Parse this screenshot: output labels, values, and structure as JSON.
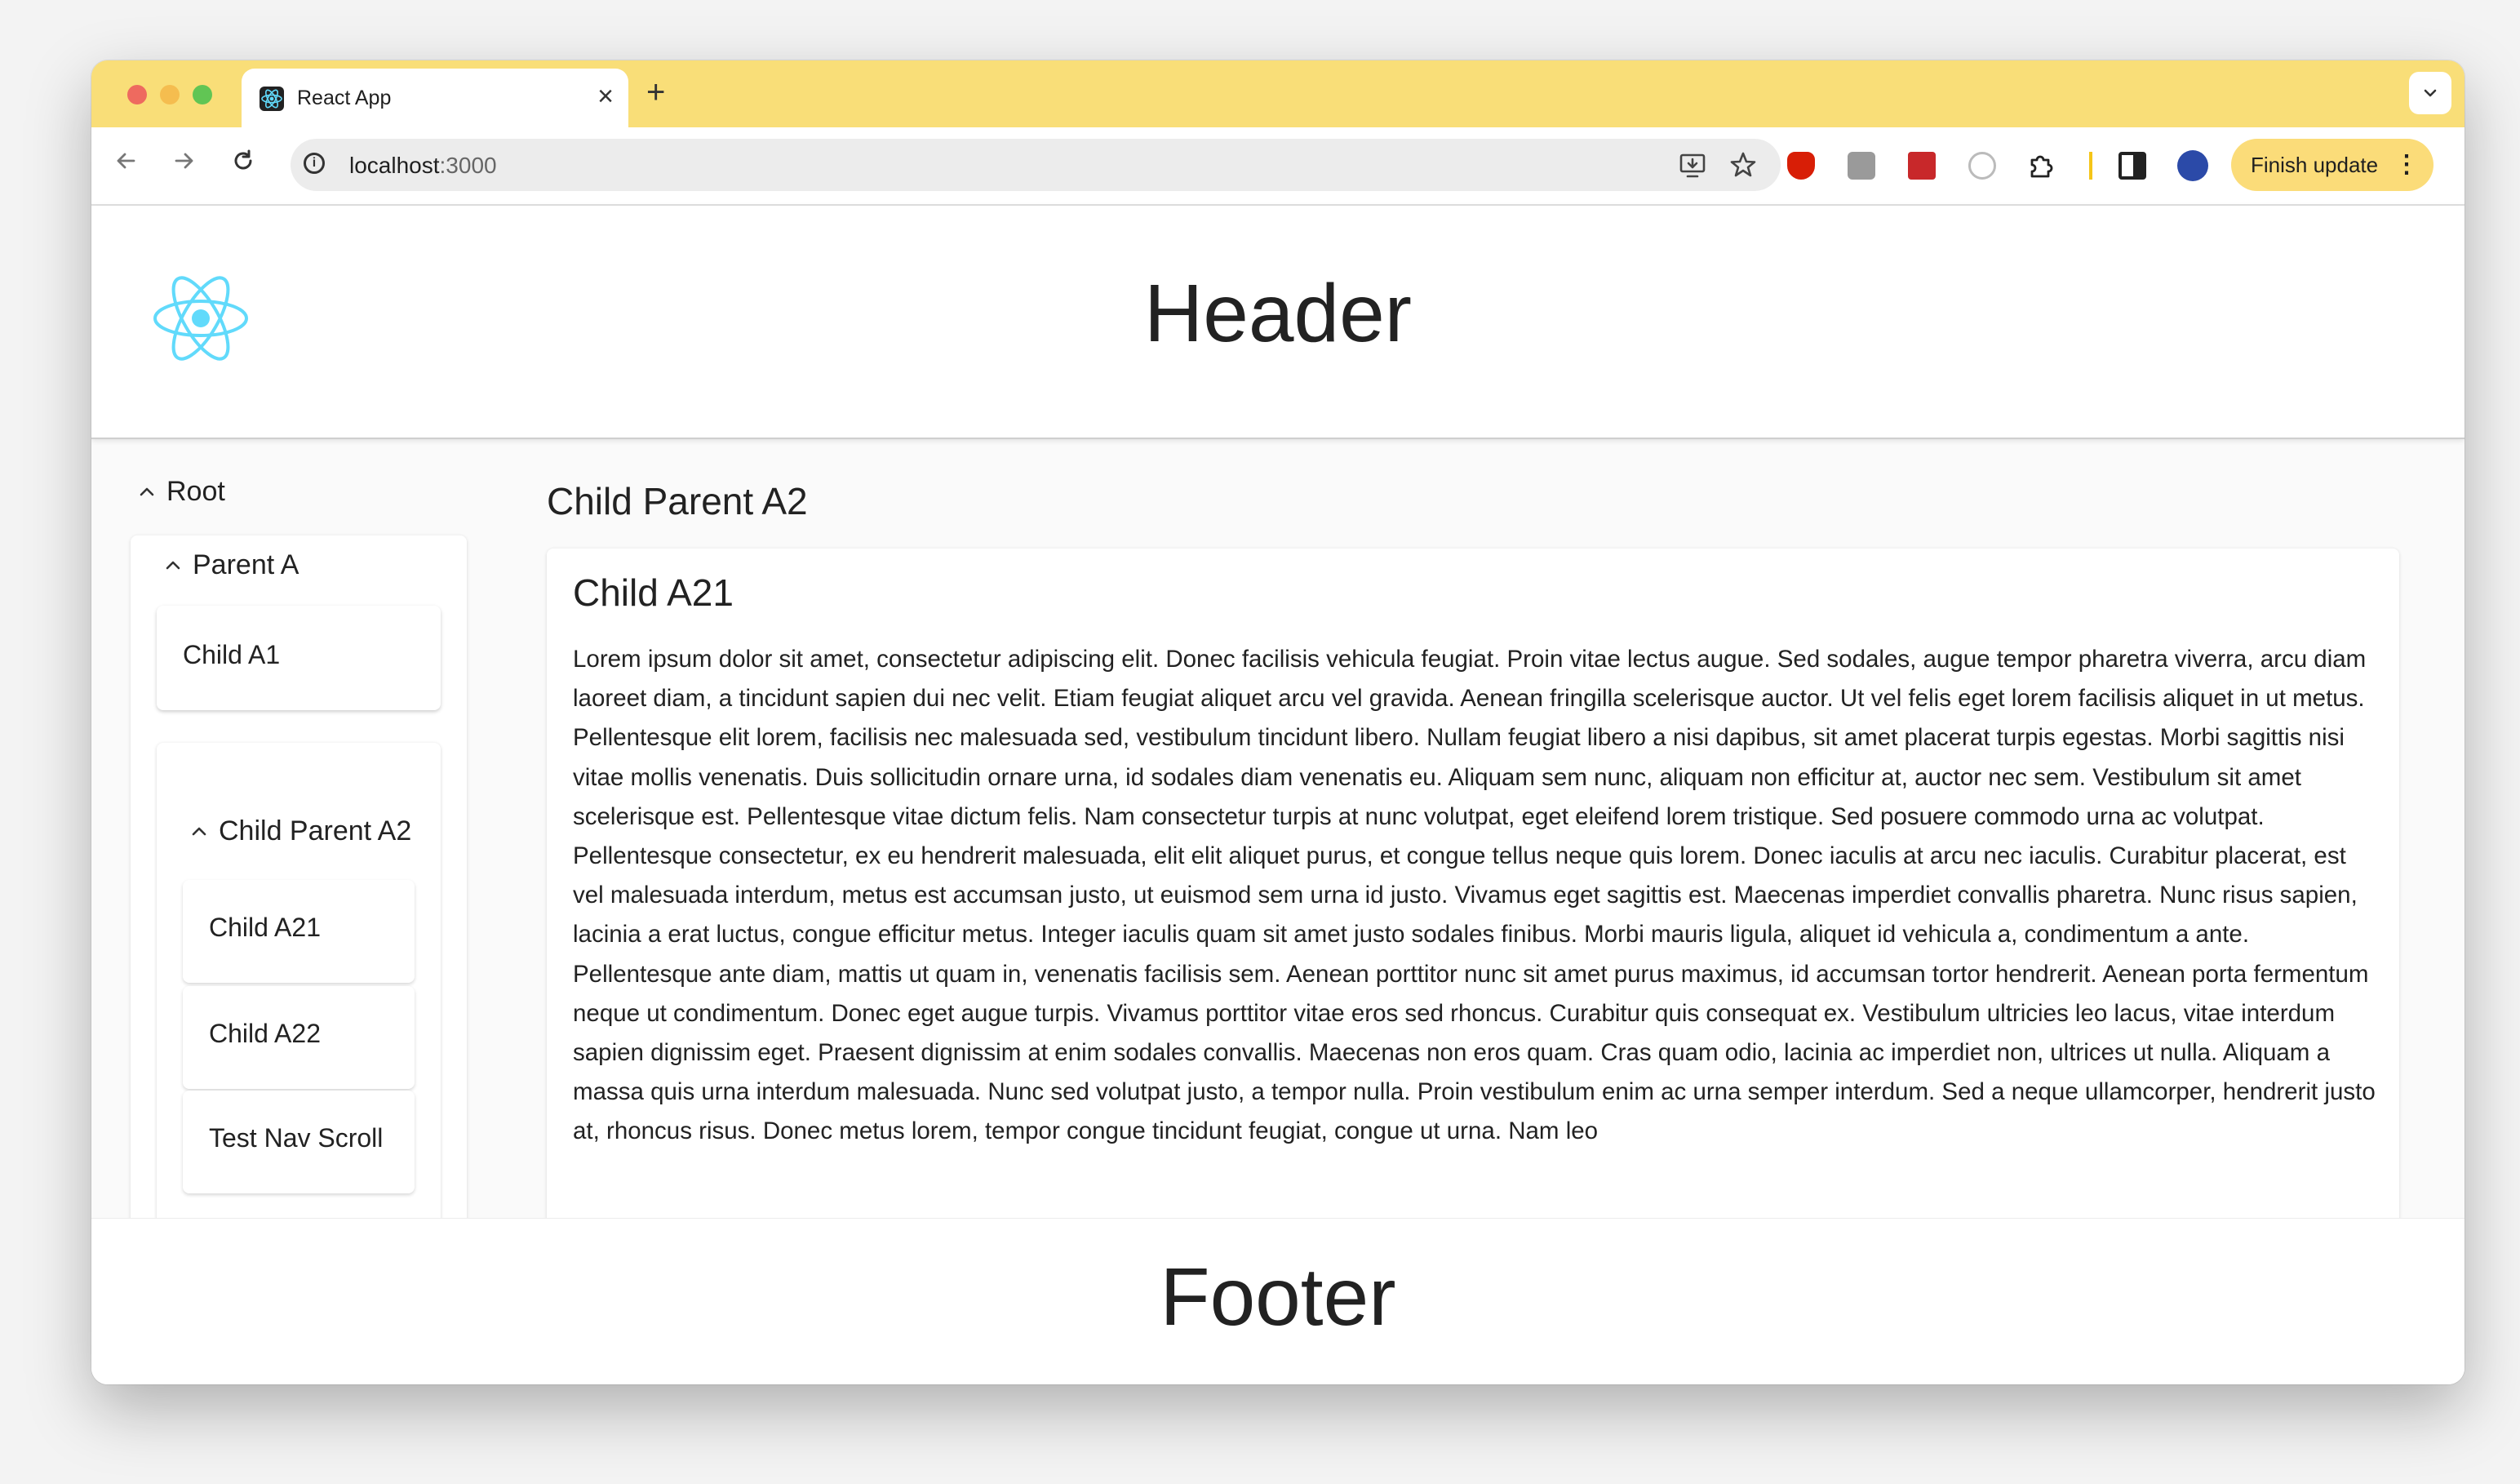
{
  "browser": {
    "tab_title": "React App",
    "tab_close": "×",
    "new_tab": "+",
    "tab_search": "⌄",
    "url_host": "localhost",
    "url_port": ":3000",
    "finish_update_label": "Finish update"
  },
  "header": {
    "title": "Header"
  },
  "sidebar": {
    "root_label": "Root",
    "parent_a_label": "Parent A",
    "child_a1_label": "Child A1",
    "child_parent_a2_label": "Child Parent A2",
    "child_a21_label": "Child A21",
    "child_a22_label": "Child A22",
    "test_nav_scroll_label": "Test Nav Scroll"
  },
  "main": {
    "section_title": "Child Parent A2",
    "card_title": "Child A21",
    "card_body": "Lorem ipsum dolor sit amet, consectetur adipiscing elit. Donec facilisis vehicula feugiat. Proin vitae lectus augue. Sed sodales, augue tempor pharetra viverra, arcu diam laoreet diam, a tincidunt sapien dui nec velit. Etiam feugiat aliquet arcu vel gravida. Aenean fringilla scelerisque auctor. Ut vel felis eget lorem facilisis aliquet in ut metus. Pellentesque elit lorem, facilisis nec malesuada sed, vestibulum tincidunt libero. Nullam feugiat libero a nisi dapibus, sit amet placerat turpis egestas. Morbi sagittis nisi vitae mollis venenatis. Duis sollicitudin ornare urna, id sodales diam venenatis eu. Aliquam sem nunc, aliquam non efficitur at, auctor nec sem. Vestibulum sit amet scelerisque est. Pellentesque vitae dictum felis. Nam consectetur turpis at nunc volutpat, eget eleifend lorem tristique. Sed posuere commodo urna ac volutpat. Pellentesque consectetur, ex eu hendrerit malesuada, elit elit aliquet purus, et congue tellus neque quis lorem. Donec iaculis at arcu nec iaculis. Curabitur placerat, est vel malesuada interdum, metus est accumsan justo, ut euismod sem urna id justo. Vivamus eget sagittis est. Maecenas imperdiet convallis pharetra. Nunc risus sapien, lacinia a erat luctus, congue efficitur metus. Integer iaculis quam sit amet justo sodales finibus. Morbi mauris ligula, aliquet id vehicula a, condimentum a ante. Pellentesque ante diam, mattis ut quam in, venenatis facilisis sem. Aenean porttitor nunc sit amet purus maximus, id accumsan tortor hendrerit. Aenean porta fermentum neque ut condimentum. Donec eget augue turpis. Vivamus porttitor vitae eros sed rhoncus. Curabitur quis consequat ex. Vestibulum ultricies leo lacus, vitae interdum sapien dignissim eget. Praesent dignissim at enim sodales convallis. Maecenas non eros quam. Cras quam odio, lacinia ac imperdiet non, ultrices ut nulla. Aliquam a massa quis urna interdum malesuada. Nunc sed volutpat justo, a tempor nulla. Proin vestibulum enim ac urna semper interdum. Sed a neque ullamcorper, hendrerit justo at, rhoncus risus. Donec metus lorem, tempor congue tincidunt feugiat, congue ut urna. Nam leo"
  },
  "footer": {
    "title": "Footer"
  },
  "colors": {
    "tab_strip": "#f9de78",
    "react_logo": "#61dafb",
    "finish_button": "#fbdc79"
  },
  "icons": {
    "back": "arrow-left-icon",
    "forward": "arrow-right-icon",
    "reload": "reload-icon",
    "site_info": "info-icon",
    "install": "install-app-icon",
    "bookmark": "star-icon",
    "extensions": "puzzle-icon",
    "tree_expanded": "chevron-up-icon"
  }
}
